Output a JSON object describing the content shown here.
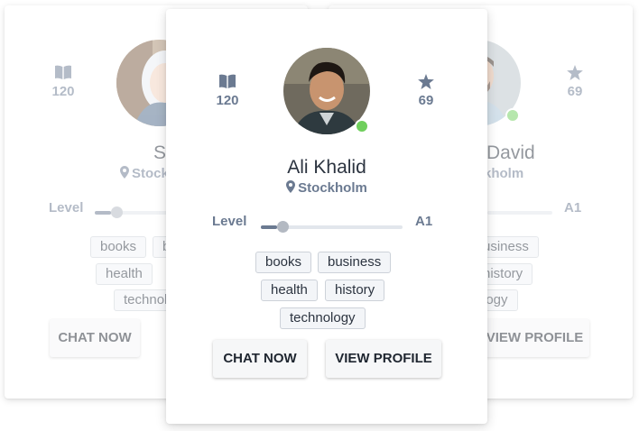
{
  "cards": {
    "left": {
      "books_count": "120",
      "name": "Sara W",
      "location": "Stockh",
      "level_label": "Level",
      "level": 0.1,
      "tags": [
        "books",
        "b",
        "health",
        "technol"
      ],
      "chat_label": "CHAT NOW",
      "avatar_icon": "avatar-woman-icon"
    },
    "center": {
      "books_count": "120",
      "stars_count": "69",
      "name": "Ali Khalid",
      "location": "Stockholm",
      "level_label": "Level",
      "level_value": "A1",
      "level": 0.1,
      "online": true,
      "tags": [
        "books",
        "business",
        "health",
        "history",
        "technology"
      ],
      "chat_label": "CHAT NOW",
      "view_label": "VIEW PROFILE",
      "avatar_icon": "avatar-man-icon"
    },
    "right": {
      "stars_count": "69",
      "name": "David",
      "location": "kholm",
      "level_value": "A1",
      "tags": [
        "usiness",
        "history",
        "logy"
      ],
      "view_label": "VIEW PROFILE",
      "online": true,
      "avatar_icon": "avatar-man-icon"
    }
  },
  "colors": {
    "online": "#6fcf5c",
    "muted_text": "#6b7a91",
    "tag_border": "#cdd2d9"
  },
  "icons": {
    "books": "book-icon",
    "stars": "star-icon",
    "location": "map-pin-icon"
  }
}
